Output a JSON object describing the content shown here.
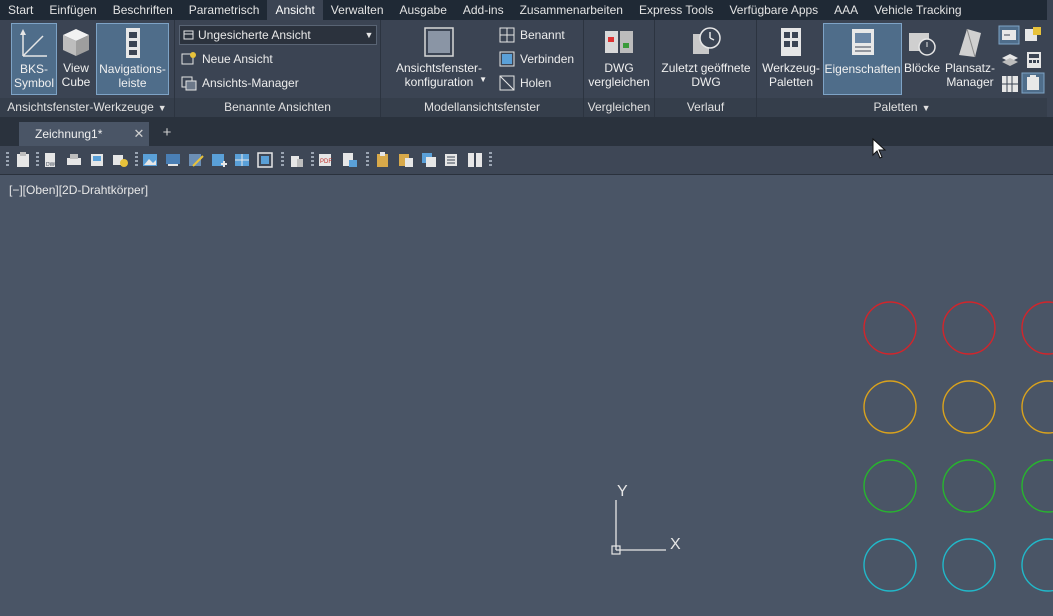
{
  "menu_tabs": [
    "Start",
    "Einfügen",
    "Beschriften",
    "Parametrisch",
    "Ansicht",
    "Verwalten",
    "Ausgabe",
    "Add-ins",
    "Zusammenarbeiten",
    "Express Tools",
    "Verfügbare Apps",
    "AAA",
    "Vehicle Tracking"
  ],
  "active_tab": "Ansicht",
  "ribbon": {
    "viewport_tools": {
      "title": "Ansichtsfenster-Werkzeuge",
      "bks_line1": "BKS-",
      "bks_line2": "Symbol",
      "viewcube_line1": "View",
      "viewcube_line2": "Cube",
      "nav_line1": "Navigations-",
      "nav_line2": "leiste"
    },
    "named_views": {
      "title": "Benannte Ansichten",
      "dropdown_value": "Ungesicherte Ansicht",
      "new_view": "Neue Ansicht",
      "view_manager": "Ansichts-Manager"
    },
    "model_viewports": {
      "title": "Modellansichtsfenster",
      "config_line1": "Ansichtsfenster-",
      "config_line2": "konfiguration",
      "named": "Benannt",
      "join": "Verbinden",
      "restore": "Holen"
    },
    "compare": {
      "title": "Vergleichen",
      "dwg_line1": "DWG",
      "dwg_line2": "vergleichen"
    },
    "history": {
      "title": "Verlauf",
      "recent_line1": "Zuletzt geöffnete",
      "recent_line2": "DWG"
    },
    "palettes": {
      "title": "Paletten",
      "tool_line1": "Werkzeug-",
      "tool_line2": "Paletten",
      "properties": "Eigenschaften",
      "blocks": "Blöcke",
      "sheetset_line1": "Plansatz-",
      "sheetset_line2": "Manager"
    }
  },
  "document": {
    "tab_name": "Zeichnung1*",
    "close_glyph": "✕",
    "add_glyph": "+"
  },
  "viewport_label": "[−][Oben][2D-Drahtkörper]",
  "ucs": {
    "x_label": "X",
    "y_label": "Y"
  },
  "circle_colors": [
    "#d2252b",
    "#d9a21d",
    "#27b52e",
    "#21b8c9"
  ],
  "colors": {
    "menu_bg": "#1f2935",
    "ribbon_bg": "#3b4453",
    "canvas_bg": "#4a5566",
    "active_button": "#4f6d8a"
  }
}
